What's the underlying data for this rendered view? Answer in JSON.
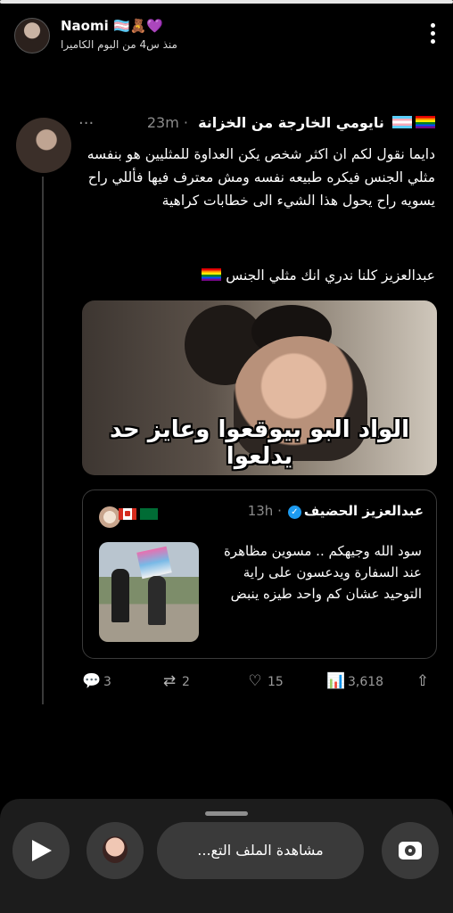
{
  "progress": 1.0,
  "story": {
    "name": "Naomi",
    "name_emoji": "🏳️‍⚧️🧸💜",
    "subtitle": "منذ س4 من البوم الكاميرا"
  },
  "tweet": {
    "display_name": "نايومي الخارجة من الخزانة",
    "time": "· 23m",
    "more": "···",
    "body": "دايما نقول لكم ان اكثر شخص يكن العداوة للمثليين هو بنفسه مثلي الجنس فيكره طبيعه نفسه ومش معترف فيها فأللي راح يسويه راح يحول هذا الشيء الى خطابات كراهية",
    "body2": "عبدالعزيز كلنا ندري انك مثلي الجنس",
    "image_caption": "الواد البو بيوقعوا وعايز حد يدلعوا"
  },
  "quote": {
    "display_name": "عبدالعزيز الحضيف",
    "verified_mark": "✓",
    "time": "· 13h",
    "text": "سود الله وجيهكم .. مسوين مظاهرة عند السفارة ويدعسون على راية التوحيد عشان كم واحد طيزه ينبض"
  },
  "actions": {
    "replies": "3",
    "retweets": "2",
    "likes": "15",
    "views": "3,618",
    "reply_icon": "💬",
    "retweet_icon": "⇄",
    "like_icon": "♡",
    "views_icon": "📊",
    "share_icon": "⇧"
  },
  "bottom": {
    "view_profile": "مشاهدة الملف التع..."
  }
}
